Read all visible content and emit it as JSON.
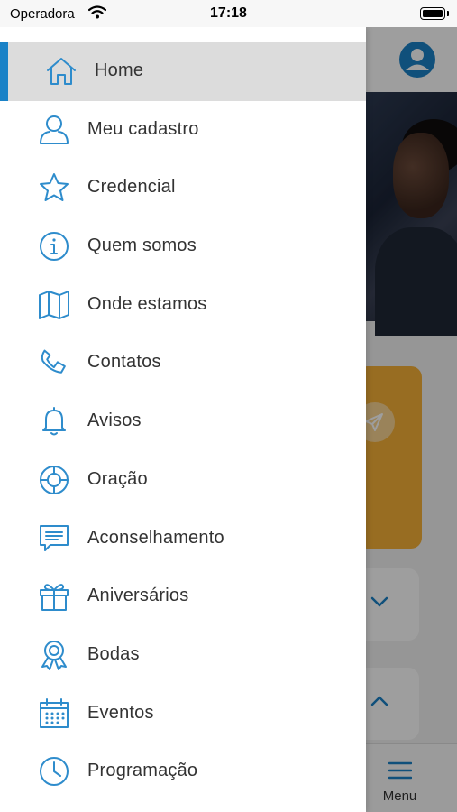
{
  "status_bar": {
    "carrier": "Operadora",
    "time": "17:18"
  },
  "drawer": {
    "items": [
      {
        "label": "Home",
        "icon": "home-icon",
        "active": true
      },
      {
        "label": "Meu cadastro",
        "icon": "user-icon"
      },
      {
        "label": "Credencial",
        "icon": "star-icon"
      },
      {
        "label": "Quem somos",
        "icon": "info-icon"
      },
      {
        "label": "Onde estamos",
        "icon": "map-icon"
      },
      {
        "label": "Contatos",
        "icon": "phone-icon"
      },
      {
        "label": "Avisos",
        "icon": "bell-icon"
      },
      {
        "label": "Oração",
        "icon": "lifebuoy-icon"
      },
      {
        "label": "Aconselhamento",
        "icon": "chat-icon"
      },
      {
        "label": "Aniversários",
        "icon": "gift-icon"
      },
      {
        "label": "Bodas",
        "icon": "award-icon"
      },
      {
        "label": "Eventos",
        "icon": "calendar-icon"
      },
      {
        "label": "Programação",
        "icon": "clock-icon"
      }
    ]
  },
  "background": {
    "tab_menu_label": "Menu"
  },
  "colors": {
    "accent": "#1a82c7",
    "icon": "#2e8ccc",
    "active_bg": "#dcdcdc",
    "card_orange": "#f5b038"
  }
}
